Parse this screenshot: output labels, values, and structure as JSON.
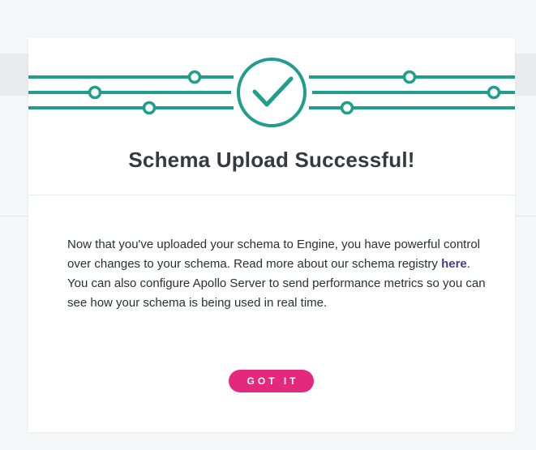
{
  "modal": {
    "title": "Schema Upload Successful!",
    "paragraph1_text": "Now that you've uploaded your schema to Engine, you have powerful control over changes to your schema. Read more about our schema registry ",
    "paragraph1_link": "here",
    "paragraph1_end": ".",
    "paragraph2_text": "You can also configure Apollo Server to send performance metrics so you can see how your schema is being used in real time.",
    "button_label": "GOT IT"
  },
  "colors": {
    "accent_green": "#1e9e8b",
    "button_pink": "#e3287e",
    "link_purple": "#4a3b8f"
  },
  "icons": {
    "hero": "success-checkmark-icon"
  }
}
